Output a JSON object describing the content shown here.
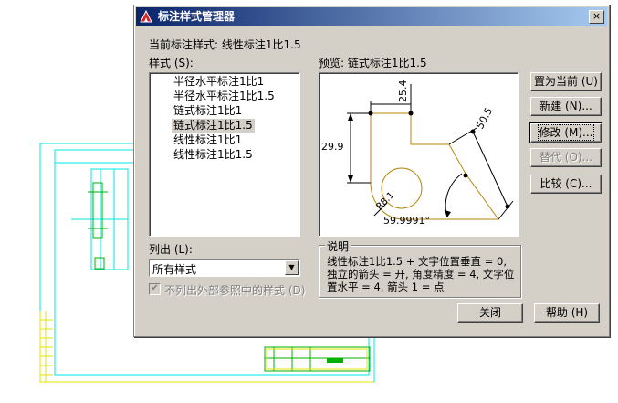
{
  "dialog": {
    "title": "标注样式管理器",
    "close_glyph": "×",
    "current_style_label": "当前标注样式: 线性标注1比1.5",
    "styles_label": "样式 (S):",
    "styles": [
      {
        "name": "半径水平标注1比1",
        "selected": false
      },
      {
        "name": "半径水平标注1比1.5",
        "selected": false
      },
      {
        "name": "链式标注1比1",
        "selected": false
      },
      {
        "name": "链式标注1比1.5",
        "selected": true
      },
      {
        "name": "线性标注1比1",
        "selected": false
      },
      {
        "name": "线性标注1比1.5",
        "selected": false
      }
    ],
    "preview_label": "预览: 链式标注1比1.5",
    "preview_dims": {
      "d1": "25.4",
      "d2": "29.9",
      "d3": "50.5",
      "d4": "R8.1",
      "d5": "59.9991°"
    },
    "list_label": "列出 (L):",
    "list_value": "所有样式",
    "list_arrow": "▼",
    "exclude_xref_label": "不列出外部参照中的样式 (D)",
    "exclude_xref_checked": true,
    "exclude_xref_check": "✔",
    "description_legend": "说明",
    "description_text": "线性标注1比1.5 + 文字位置垂直 = 0, 独立的箭头 = 开, 角度精度 = 4, 文字位置水平 = 4, 箭头 1 = 点",
    "buttons": {
      "set_current": "置为当前 (U)",
      "new": "新建 (N)...",
      "modify": "修改 (M)...",
      "override": "替代 (O)...",
      "compare": "比较 (C)...",
      "close": "关闭",
      "help": "帮助 (H)"
    }
  },
  "colors": {
    "title_bar_start": "#0a246a",
    "dialog_bg": "#d4d0c8",
    "cad_cyan": "#00e5e5",
    "cad_yellow": "#e5e500",
    "cad_green": "#00b000",
    "preview_geometry": "#b8860b"
  }
}
